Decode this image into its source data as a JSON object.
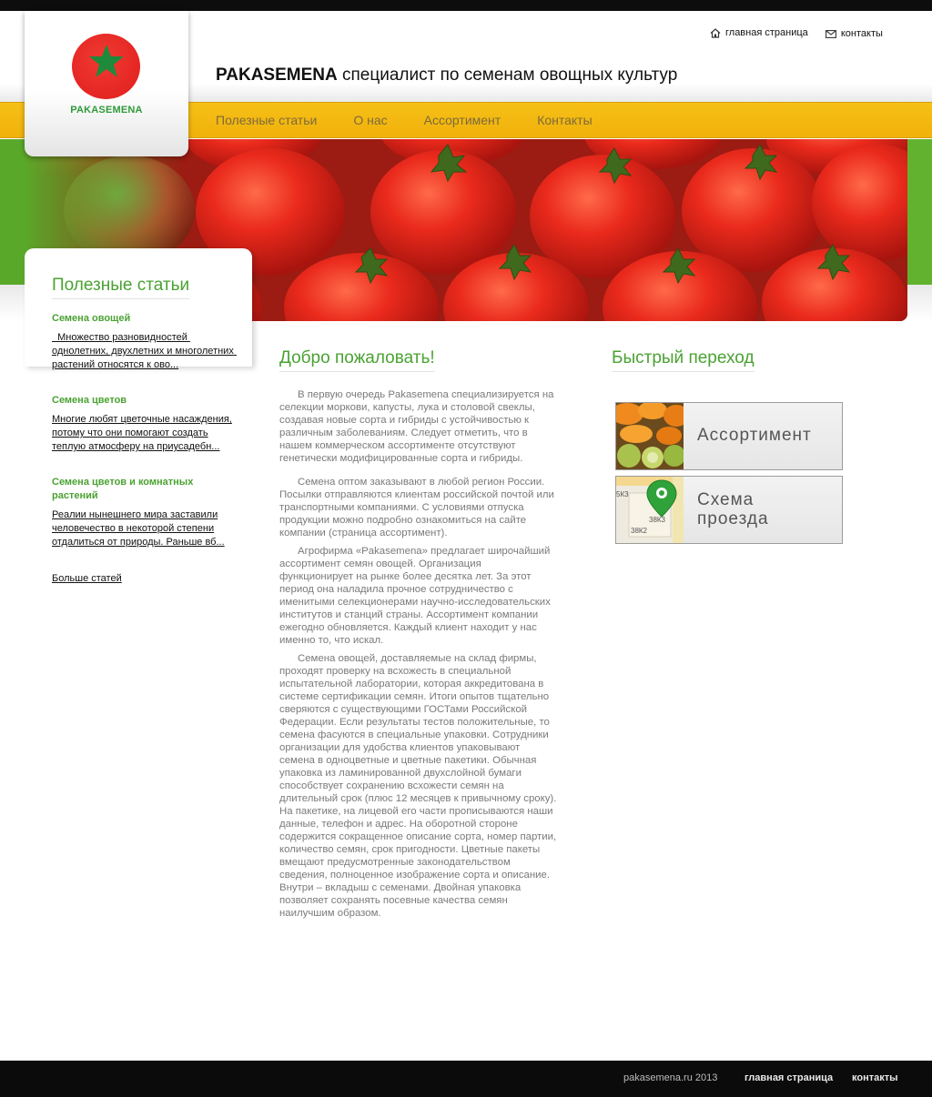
{
  "header": {
    "brand": "PAKASEMENA",
    "tagline": "специалист по семенам овощных культур",
    "logo_text": "PAKASEMENA",
    "top_links": {
      "home": "главная страница",
      "contacts": "контакты"
    }
  },
  "nav": {
    "items": [
      "Полезные статьи",
      "О нас",
      "Ассортимент",
      "Контакты"
    ]
  },
  "sidebar": {
    "title": "Полезные статьи",
    "articles": [
      {
        "title": "Семена овощей",
        "text": "  Множество разновидностей однолетних, двухлетних и многолетних растений относятся к ово..."
      },
      {
        "title": "Семена цветов",
        "text": "Многие любят цветочные насаждения, потому что они помогают создать теплую атмосферу на приусадебн..."
      },
      {
        "title": "Семена цветов и комнатных растений",
        "text": "Реалии нынешнего мира заставили человечество в некоторой степени отдалиться от природы. Раньше вб..."
      }
    ],
    "more": "Больше статей"
  },
  "main": {
    "title": "Добро пожаловать!",
    "paragraphs": [
      "В первую очередь Pakasemena специализируется на селекции моркови, капусты, лука и столовой свеклы, создавая новые сорта и гибриды с устойчивостью к различным заболеваниям. Следует отметить, что в нашем коммерческом ассортименте отсутствуют генетически модифицированные сорта и гибриды.",
      "Семена оптом заказывают в любой регион России. Посылки отправляются клиентам российской почтой или транспортными компаниями. С условиями отпуска продукции можно подробно ознакомиться на сайте компании (страница ассортимент).",
      "Агрофирма «Pakasemena» предлагает широчайший ассортимент семян овощей. Организация функционирует на рынке более десятка лет. За этот период она наладила прочное сотрудничество с именитыми селекционерами научно-исследовательских институтов и станций страны. Ассортимент компании ежегодно обновляется. Каждый клиент находит у нас именно то, что искал.",
      "Семена овощей, доставляемые на склад фирмы, проходят проверку на всхожесть в специальной испытательной лаборатории, которая аккредитована в системе сертификации семян. Итоги опытов тщательно сверяются с существующими ГОСТами Российской Федерации. Если результаты тестов положительные, то семена фасуются в специальные упаковки. Сотрудники организации для удобства клиентов упаковывают семена в одноцветные и цветные пакетики. Обычная упаковка из ламинированной двухслойной бумаги способствует сохранению всхожести семян на длительный срок (плюс 12 месяцев к привычному сроку). На пакетике, на лицевой его части прописываются наши данные, телефон и адрес. На оборотной стороне содержится сокращенное описание сорта, номер партии, количество семян, срок пригодности. Цветные пакеты вмещают предусмотренные законодательством сведения, полноценное изображение сорта и описание. Внутри – вкладыш с семенами. Двойная упаковка позволяет сохранять посевные качества семян наилучшим образом."
    ]
  },
  "quick": {
    "title": "Быстрый переход",
    "assortment": "Ассортимент",
    "route_line1": "Схема",
    "route_line2": "проезда",
    "map_labels": [
      "5К3",
      "38К3",
      "38К2"
    ]
  },
  "footer": {
    "copyright": "pakasemena.ru 2013",
    "home": "главная страница",
    "contacts": "контакты"
  },
  "colors": {
    "accent_green": "#4aa232",
    "nav_yellow": "#f4b915",
    "band_green": "#5ea92b",
    "footer_bg": "#0b0b0b"
  },
  "icons": [
    "home-icon",
    "mail-icon",
    "star-icon",
    "map-pin-icon"
  ]
}
